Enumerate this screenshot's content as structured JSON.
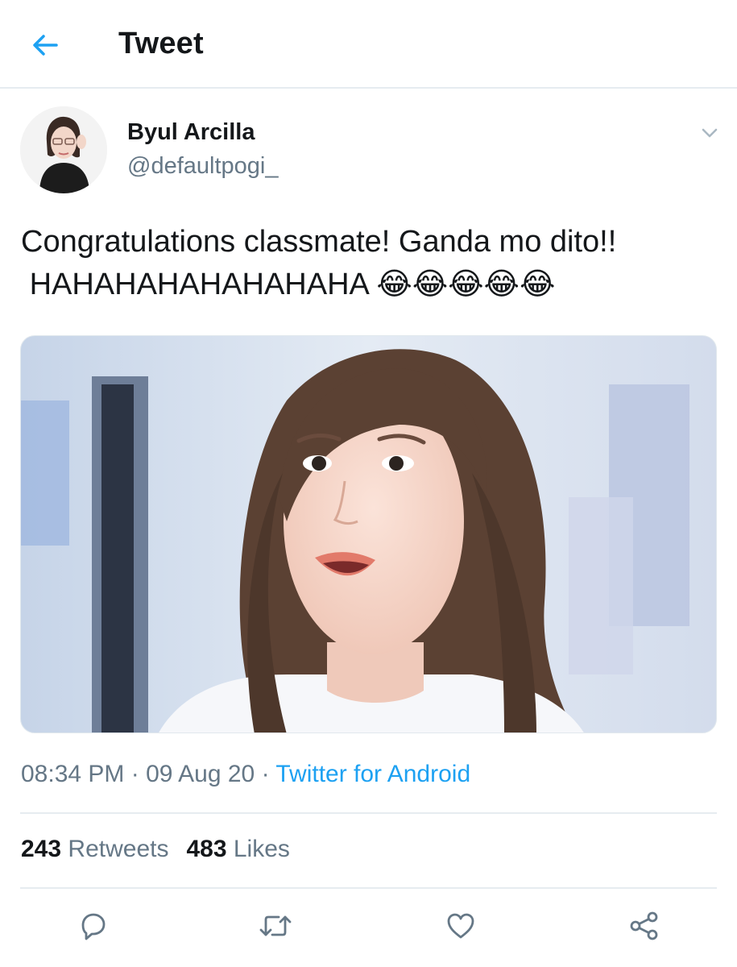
{
  "header": {
    "title": "Tweet",
    "back_icon": "arrow-left-icon"
  },
  "author": {
    "name": "Byul Arcilla",
    "handle": "@defaultpogi_"
  },
  "tweet": {
    "line1": "Congratulations classmate! Ganda mo dito!!",
    "line2": "HAHAHAHAHAHAHAHA",
    "emojis": "😂😂😂😂😂"
  },
  "meta": {
    "time": "08:34 PM",
    "separator1": " · ",
    "date": "09 Aug 20",
    "separator2": " · ",
    "source": "Twitter for Android"
  },
  "stats": {
    "retweets_count": "243",
    "retweets_label": "Retweets",
    "likes_count": "483",
    "likes_label": "Likes"
  },
  "actions": {
    "reply_icon": "reply-icon",
    "retweet_icon": "retweet-icon",
    "like_icon": "heart-icon",
    "share_icon": "share-icon"
  },
  "colors": {
    "accent": "#1da1f2",
    "text": "#14171a",
    "secondary": "#657786",
    "divider": "#e6ecf0"
  }
}
